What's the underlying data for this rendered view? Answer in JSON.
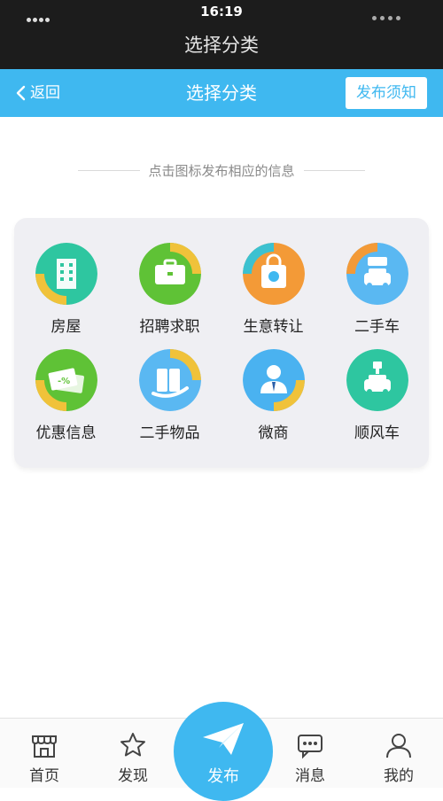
{
  "status_bar": {
    "time": "16:19"
  },
  "system_title": "选择分类",
  "nav": {
    "back_label": "返回",
    "title": "选择分类",
    "notice_label": "发布须知"
  },
  "hint": "点击图标发布相应的信息",
  "categories": [
    {
      "label": "房屋",
      "icon": "building-icon",
      "color": "#2ec6a0"
    },
    {
      "label": "招聘求职",
      "icon": "briefcase-icon",
      "color": "#5fc236"
    },
    {
      "label": "生意转让",
      "icon": "shopping-bag-icon",
      "color": "#f39a37"
    },
    {
      "label": "二手车",
      "icon": "used-car-icon",
      "color": "#5ab8f2"
    },
    {
      "label": "优惠信息",
      "icon": "coupon-icon",
      "color": "#5fc236"
    },
    {
      "label": "二手物品",
      "icon": "luggage-icon",
      "color": "#5ab8f2"
    },
    {
      "label": "微商",
      "icon": "businessman-icon",
      "color": "#4ab2f0"
    },
    {
      "label": "顺风车",
      "icon": "carpool-icon",
      "color": "#2ec6a0"
    }
  ],
  "tabs": [
    {
      "label": "首页",
      "icon": "storefront-icon"
    },
    {
      "label": "发现",
      "icon": "star-icon"
    },
    {
      "label": "发布",
      "icon": "paper-plane-icon"
    },
    {
      "label": "消息",
      "icon": "chat-bubble-icon"
    },
    {
      "label": "我的",
      "icon": "person-icon"
    }
  ],
  "colors": {
    "accent": "#3fb8f0",
    "dark_bar": "#1c1c1c",
    "card_bg": "#efeff3"
  }
}
